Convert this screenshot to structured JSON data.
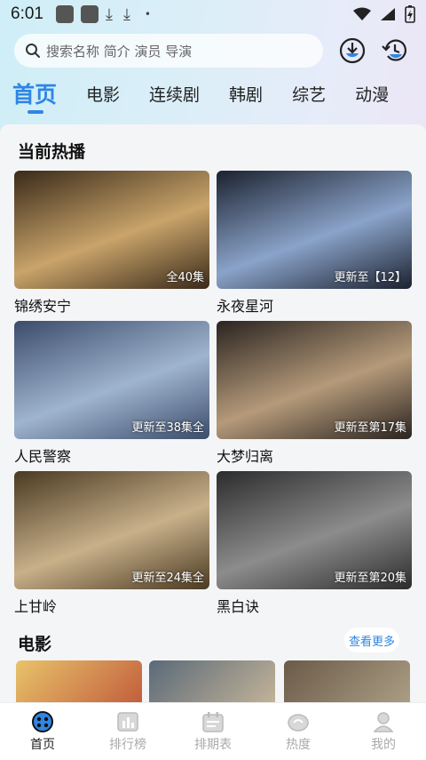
{
  "status_bar": {
    "time": "6:01",
    "dl1": "⤓",
    "dl2": "⤓",
    "dot": "•"
  },
  "search": {
    "placeholder": "搜索名称 简介 演员 导演"
  },
  "header_buttons": [
    {
      "icon": "download-icon"
    },
    {
      "icon": "history-icon"
    }
  ],
  "category_tabs": [
    {
      "label": "首页",
      "active": true
    },
    {
      "label": "电影"
    },
    {
      "label": "连续剧"
    },
    {
      "label": "韩剧"
    },
    {
      "label": "综艺"
    },
    {
      "label": "动漫"
    }
  ],
  "sections": {
    "hot": {
      "title": "当前热播",
      "items": [
        {
          "title": "锦绣安宁",
          "badge": "全40集",
          "colors": [
            "#3a2a1a",
            "#c9a46a"
          ]
        },
        {
          "title": "永夜星河",
          "badge": "更新至【12】",
          "colors": [
            "#1c2230",
            "#8aa3c9"
          ]
        },
        {
          "title": "人民警察",
          "badge": "更新至38集全",
          "colors": [
            "#3b4c6a",
            "#9fb4cf"
          ]
        },
        {
          "title": "大梦归离",
          "badge": "更新至第17集",
          "colors": [
            "#2a2420",
            "#b59a7a"
          ]
        },
        {
          "title": "上甘岭",
          "badge": "更新至24集全",
          "colors": [
            "#4a3a22",
            "#c8b08a"
          ]
        },
        {
          "title": "黑白诀",
          "badge": "更新至第20集",
          "colors": [
            "#2c2c2c",
            "#8c8c8c"
          ]
        }
      ]
    },
    "movies": {
      "title": "电影",
      "more_label": "查看更多"
    }
  },
  "bottom_nav": [
    {
      "label": "首页",
      "icon": "home-icon",
      "active": true
    },
    {
      "label": "排行榜",
      "icon": "ranking-icon"
    },
    {
      "label": "排期表",
      "icon": "schedule-icon"
    },
    {
      "label": "热度",
      "icon": "trending-icon"
    },
    {
      "label": "我的",
      "icon": "profile-icon"
    }
  ],
  "colors": {
    "accent": "#2f86e3",
    "inactive": "#aaaaaa",
    "background": "#f4f5f7"
  }
}
